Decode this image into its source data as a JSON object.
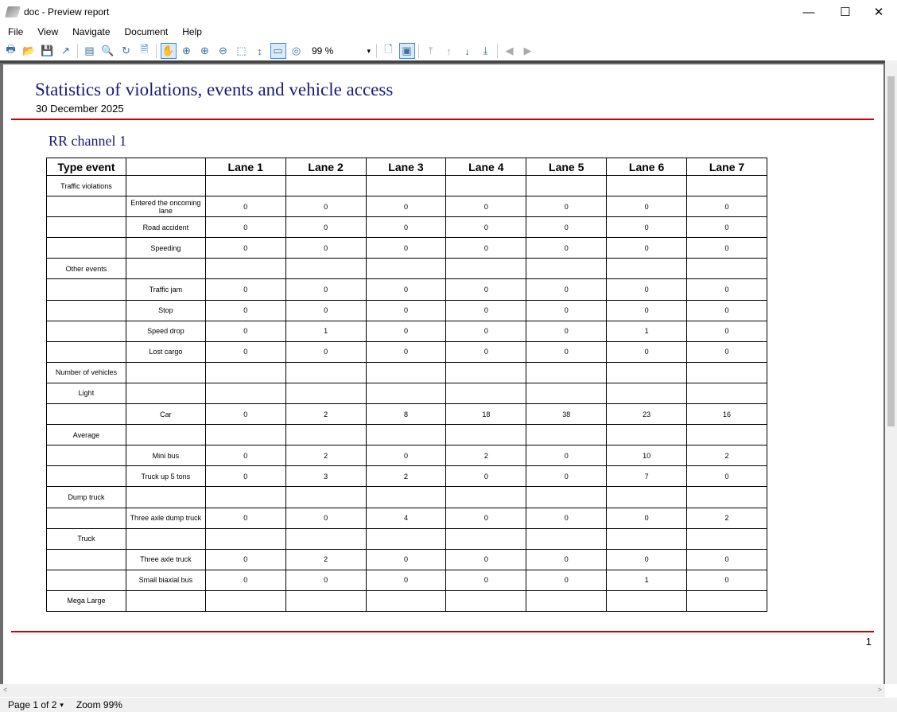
{
  "window": {
    "title": "doc - Preview report",
    "minimize": "—",
    "maximize": "☐",
    "close": "✕"
  },
  "menu": [
    "File",
    "View",
    "Navigate",
    "Document",
    "Help"
  ],
  "toolbar": {
    "zoom_value": "99 %",
    "zoom_arrow": "▾",
    "icons": [
      "print-icon",
      "open-icon",
      "save-icon",
      "export-icon",
      "page-setup-icon",
      "find-icon",
      "refresh-icon",
      "preview-icon",
      "hand-icon",
      "zoom-icon",
      "zoom-in-icon",
      "zoom-out-icon",
      "zoom-rect-icon",
      "fit-width-icon",
      "fit-page-icon",
      "zoom-100-icon",
      "single-page-icon",
      "multi-page-icon",
      "first-page-icon",
      "prev-page-icon",
      "next-page-icon",
      "last-page-icon",
      "back-icon",
      "forward-icon"
    ]
  },
  "report": {
    "title": "Statistics of violations, events and vehicle access",
    "date": "30 December 2025",
    "channel": "RR channel 1",
    "headers": [
      "Type event",
      "",
      "Lane 1",
      "Lane 2",
      "Lane 3",
      "Lane 4",
      "Lane 5",
      "Lane 6",
      "Lane 7"
    ],
    "rows": [
      {
        "type": "Traffic violations",
        "sub": "",
        "values": [
          "",
          "",
          "",
          "",
          "",
          "",
          ""
        ]
      },
      {
        "type": "",
        "sub": "Entered the oncoming lane",
        "values": [
          "0",
          "0",
          "0",
          "0",
          "0",
          "0",
          "0"
        ]
      },
      {
        "type": "",
        "sub": "Road accident",
        "values": [
          "0",
          "0",
          "0",
          "0",
          "0",
          "0",
          "0"
        ]
      },
      {
        "type": "",
        "sub": "Speeding",
        "values": [
          "0",
          "0",
          "0",
          "0",
          "0",
          "0",
          "0"
        ]
      },
      {
        "type": "Other events",
        "sub": "",
        "values": [
          "",
          "",
          "",
          "",
          "",
          "",
          ""
        ]
      },
      {
        "type": "",
        "sub": "Traffic jam",
        "values": [
          "0",
          "0",
          "0",
          "0",
          "0",
          "0",
          "0"
        ]
      },
      {
        "type": "",
        "sub": "Stop",
        "values": [
          "0",
          "0",
          "0",
          "0",
          "0",
          "0",
          "0"
        ]
      },
      {
        "type": "",
        "sub": "Speed drop",
        "values": [
          "0",
          "1",
          "0",
          "0",
          "0",
          "1",
          "0"
        ]
      },
      {
        "type": "",
        "sub": "Lost cargo",
        "values": [
          "0",
          "0",
          "0",
          "0",
          "0",
          "0",
          "0"
        ]
      },
      {
        "type": "Number of vehicles",
        "sub": "",
        "values": [
          "",
          "",
          "",
          "",
          "",
          "",
          ""
        ]
      },
      {
        "type": "Light",
        "sub": "",
        "values": [
          "",
          "",
          "",
          "",
          "",
          "",
          ""
        ]
      },
      {
        "type": "",
        "sub": "Car",
        "values": [
          "0",
          "2",
          "8",
          "18",
          "38",
          "23",
          "16"
        ]
      },
      {
        "type": "Average",
        "sub": "",
        "values": [
          "",
          "",
          "",
          "",
          "",
          "",
          ""
        ]
      },
      {
        "type": "",
        "sub": "Mini bus",
        "values": [
          "0",
          "2",
          "0",
          "2",
          "0",
          "10",
          "2"
        ]
      },
      {
        "type": "",
        "sub": "Truck up 5 tons",
        "values": [
          "0",
          "3",
          "2",
          "0",
          "0",
          "7",
          "0"
        ]
      },
      {
        "type": "Dump truck",
        "sub": "",
        "values": [
          "",
          "",
          "",
          "",
          "",
          "",
          ""
        ]
      },
      {
        "type": "",
        "sub": "Three axle dump truck",
        "values": [
          "0",
          "0",
          "4",
          "0",
          "0",
          "0",
          "2"
        ]
      },
      {
        "type": "Truck",
        "sub": "",
        "values": [
          "",
          "",
          "",
          "",
          "",
          "",
          ""
        ]
      },
      {
        "type": "",
        "sub": "Three axle truck",
        "values": [
          "0",
          "2",
          "0",
          "0",
          "0",
          "0",
          "0"
        ]
      },
      {
        "type": "",
        "sub": "Small biaxial bus",
        "values": [
          "0",
          "0",
          "0",
          "0",
          "0",
          "1",
          "0"
        ]
      },
      {
        "type": "Mega Large",
        "sub": "",
        "values": [
          "",
          "",
          "",
          "",
          "",
          "",
          ""
        ]
      }
    ],
    "page_number": "1"
  },
  "status": {
    "page": "Page 1 of 2",
    "page_arrow": "▾",
    "zoom": "Zoom 99%"
  }
}
